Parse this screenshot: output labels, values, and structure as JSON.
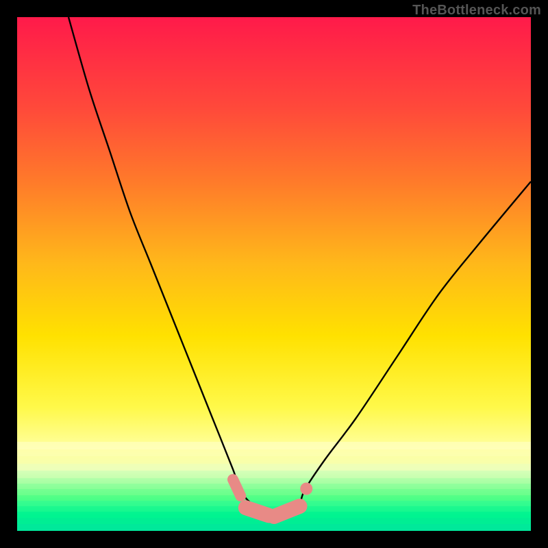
{
  "watermark": "TheBottleneck.com",
  "chart_data": {
    "type": "line",
    "title": "",
    "xlabel": "",
    "ylabel": "",
    "xlim": [
      0,
      100
    ],
    "ylim": [
      0,
      100
    ],
    "grid": false,
    "legend": false,
    "series": [
      {
        "name": "curve",
        "style": "black-thin",
        "x": [
          10,
          14,
          18,
          22,
          26,
          30,
          34,
          38,
          42,
          43,
          44,
          46,
          48,
          50,
          52,
          54,
          55,
          56,
          60,
          66,
          74,
          82,
          90,
          100
        ],
        "y": [
          100,
          86,
          74,
          62,
          52,
          42,
          32,
          22,
          12,
          9,
          7,
          5,
          4,
          3,
          3,
          4,
          5,
          8,
          14,
          22,
          34,
          46,
          56,
          68
        ]
      }
    ],
    "markers": [
      {
        "shape": "pill",
        "x0": 42.0,
        "y0": 10.0,
        "x1": 43.5,
        "y1": 6.8,
        "class": "pill-thin"
      },
      {
        "shape": "pill",
        "x0": 44.5,
        "y0": 4.5,
        "x1": 49.0,
        "y1": 3.0,
        "class": "pill"
      },
      {
        "shape": "pill",
        "x0": 50.0,
        "y0": 2.8,
        "x1": 55.0,
        "y1": 4.8,
        "class": "pill"
      },
      {
        "shape": "dot",
        "x": 56.3,
        "y": 8.2,
        "r": 9
      },
      {
        "shape": "dot",
        "x": 55.2,
        "y": 5.2,
        "r": 6
      }
    ],
    "background_gradient_stops": [
      {
        "pct": 0,
        "color": "#ff1a4a"
      },
      {
        "pct": 32,
        "color": "#ff7a2a"
      },
      {
        "pct": 62,
        "color": "#ffe100"
      },
      {
        "pct": 84,
        "color": "#ffffa0"
      },
      {
        "pct": 97,
        "color": "#00ff80"
      }
    ],
    "horizontal_bands_bottom": [
      {
        "top_pct": 82.7,
        "h_pct": 1.4,
        "color": "rgba(255,255,200,0.6)"
      },
      {
        "top_pct": 84.1,
        "h_pct": 1.4,
        "color": "rgba(255,255,180,0.5)"
      },
      {
        "top_pct": 85.5,
        "h_pct": 1.4,
        "color": "rgba(255,255,160,0.5)"
      },
      {
        "top_pct": 86.9,
        "h_pct": 1.4,
        "color": "rgba(240,255,180,0.5)"
      },
      {
        "top_pct": 88.3,
        "h_pct": 1.4,
        "color": "rgba(200,255,180,0.5)"
      },
      {
        "top_pct": 89.7,
        "h_pct": 1.1,
        "color": "rgba(160,255,170,0.5)"
      },
      {
        "top_pct": 90.8,
        "h_pct": 1.1,
        "color": "rgba(120,255,160,0.5)"
      },
      {
        "top_pct": 91.9,
        "h_pct": 1.1,
        "color": "rgba( 90,255,150,0.55)"
      },
      {
        "top_pct": 93.0,
        "h_pct": 1.1,
        "color": "rgba( 60,255,140,0.6)"
      },
      {
        "top_pct": 94.1,
        "h_pct": 1.1,
        "color": "rgba( 40,250,150,0.65)"
      },
      {
        "top_pct": 95.2,
        "h_pct": 1.1,
        "color": "rgba( 20,245,150,0.7)"
      },
      {
        "top_pct": 96.3,
        "h_pct": 1.1,
        "color": "rgba(  0,240,150,0.75)"
      },
      {
        "top_pct": 97.4,
        "h_pct": 1.3,
        "color": "rgba(  0,235,150,0.8)"
      },
      {
        "top_pct": 98.7,
        "h_pct": 1.3,
        "color": "rgba(  0,230,155,0.85)"
      }
    ]
  }
}
